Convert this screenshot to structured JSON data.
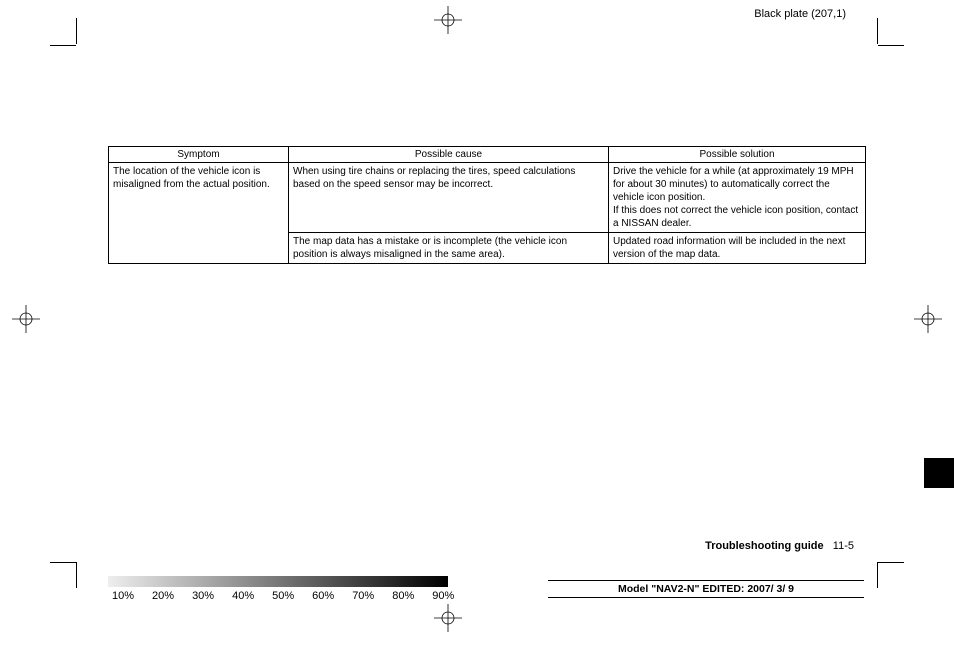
{
  "plate_label": "Black plate (207,1)",
  "table": {
    "headers": [
      "Symptom",
      "Possible cause",
      "Possible solution"
    ],
    "rows": [
      {
        "symptom": "The location of the vehicle icon is misaligned from the actual position.",
        "cause": "When using tire chains or replacing the tires, speed calculations based on the speed sensor may be incorrect.",
        "solution": "Drive the vehicle for a while (at approximately 19 MPH for about 30 minutes) to automatically correct the vehicle icon position.\nIf this does not correct the vehicle icon position, contact a NISSAN dealer."
      },
      {
        "symptom": "",
        "cause": "The map data has a mistake or is incomplete (the vehicle icon position is always misaligned in the same area).",
        "solution": "Updated road information will be included in the next version of the map data."
      }
    ]
  },
  "footer": {
    "section_label": "Troubleshooting guide",
    "page_num": "11-5"
  },
  "model_bar": "Model \"NAV2-N\" EDITED: 2007/ 3/ 9",
  "percents": [
    "10%",
    "20%",
    "30%",
    "40%",
    "50%",
    "60%",
    "70%",
    "80%",
    "90%"
  ]
}
